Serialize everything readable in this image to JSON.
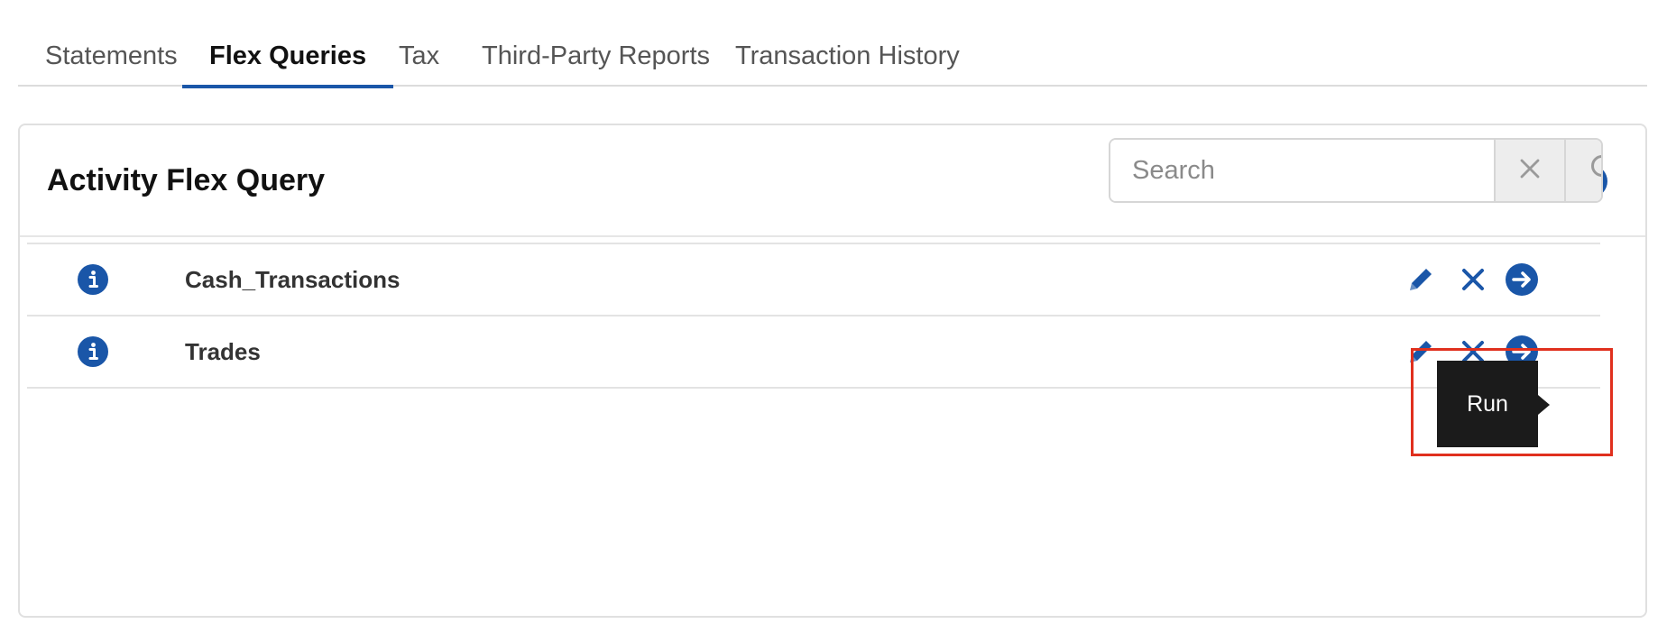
{
  "tabs": [
    {
      "label": "Statements",
      "active": false
    },
    {
      "label": "Flex Queries",
      "active": true
    },
    {
      "label": "Tax",
      "active": false
    },
    {
      "label": "Third-Party Reports",
      "active": false
    },
    {
      "label": "Transaction History",
      "active": false
    }
  ],
  "panel": {
    "title": "Activity Flex Query",
    "icons": {
      "add": "plus-icon",
      "help": "help-circle-icon"
    }
  },
  "search": {
    "placeholder": "Search",
    "value": "",
    "icons": {
      "clear": "close-icon",
      "submit": "search-icon"
    }
  },
  "queries": [
    {
      "name": "Cash_Transactions"
    },
    {
      "name": "Trades"
    }
  ],
  "row_icons": {
    "info": "info-icon",
    "edit": "pencil-icon",
    "delete": "close-icon",
    "run": "arrow-right-circle-icon"
  },
  "tooltip": {
    "text": "Run"
  },
  "colors": {
    "accent": "#1a56a8",
    "highlight": "#e0301e",
    "tooltip_bg": "#1b1b1b"
  }
}
